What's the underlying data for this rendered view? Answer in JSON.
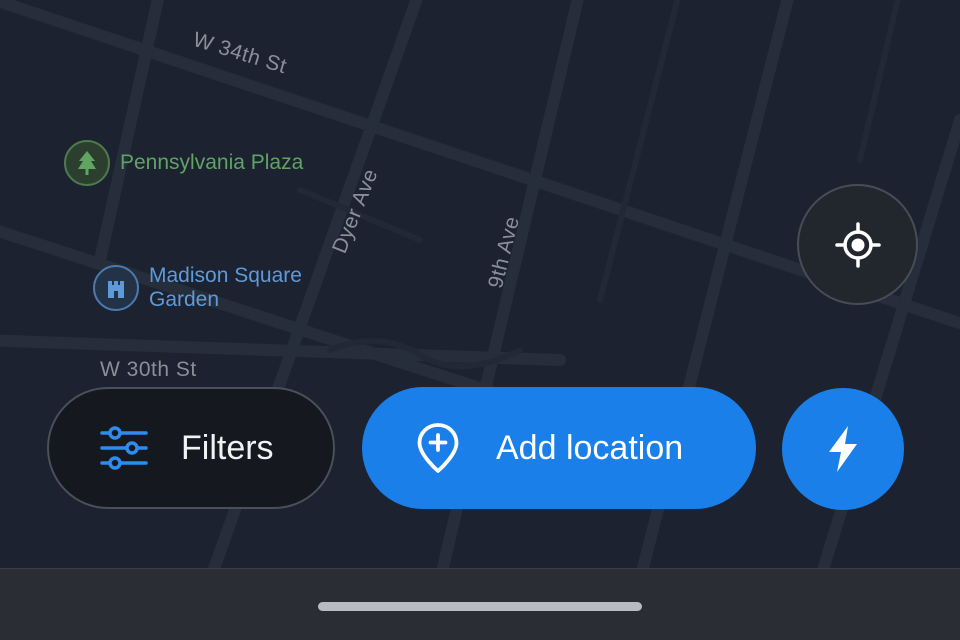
{
  "map": {
    "streets": [
      {
        "id": "w34",
        "label": "W 34th St"
      },
      {
        "id": "dyer",
        "label": "Dyer Ave"
      },
      {
        "id": "ninth",
        "label": "9th Ave"
      },
      {
        "id": "w30",
        "label": "W 30th St"
      }
    ],
    "pois": [
      {
        "label": "Pennsylvania Plaza",
        "icon": "tree-icon",
        "color": "#5fa463"
      },
      {
        "label": "Madison Square Garden",
        "icon": "venue-icon",
        "color": "#5f9ad8"
      }
    ]
  },
  "controls": {
    "locate_icon": "my-location-icon",
    "filters_label": "Filters",
    "filters_icon": "sliders-icon",
    "add_location_label": "Add location",
    "add_location_icon": "add-pin-icon",
    "quick_icon": "lightning-icon",
    "accent_color": "#1a7fe8"
  }
}
